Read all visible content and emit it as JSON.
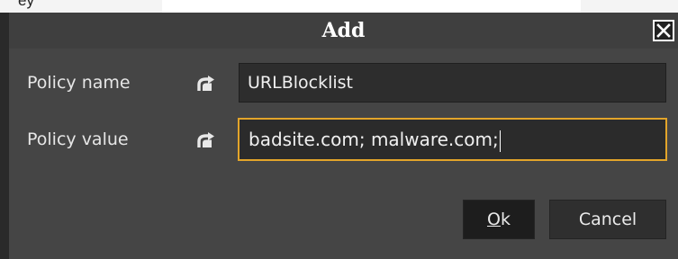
{
  "background": {
    "visible_text": "ey"
  },
  "dialog": {
    "title": "Add",
    "close_icon": "close-icon",
    "rows": [
      {
        "label": "Policy name",
        "value": "URLBlocklist",
        "reset_icon": "reset-icon"
      },
      {
        "label": "Policy value",
        "value": "badsite.com; malware.com;",
        "reset_icon": "reset-icon"
      }
    ],
    "buttons": {
      "ok_mnemonic": "O",
      "ok_rest": "k",
      "cancel_label": "Cancel"
    }
  },
  "colors": {
    "focus_accent": "#e3a52a",
    "dialog_bg": "#454545",
    "field_bg": "#2d2d2d"
  }
}
